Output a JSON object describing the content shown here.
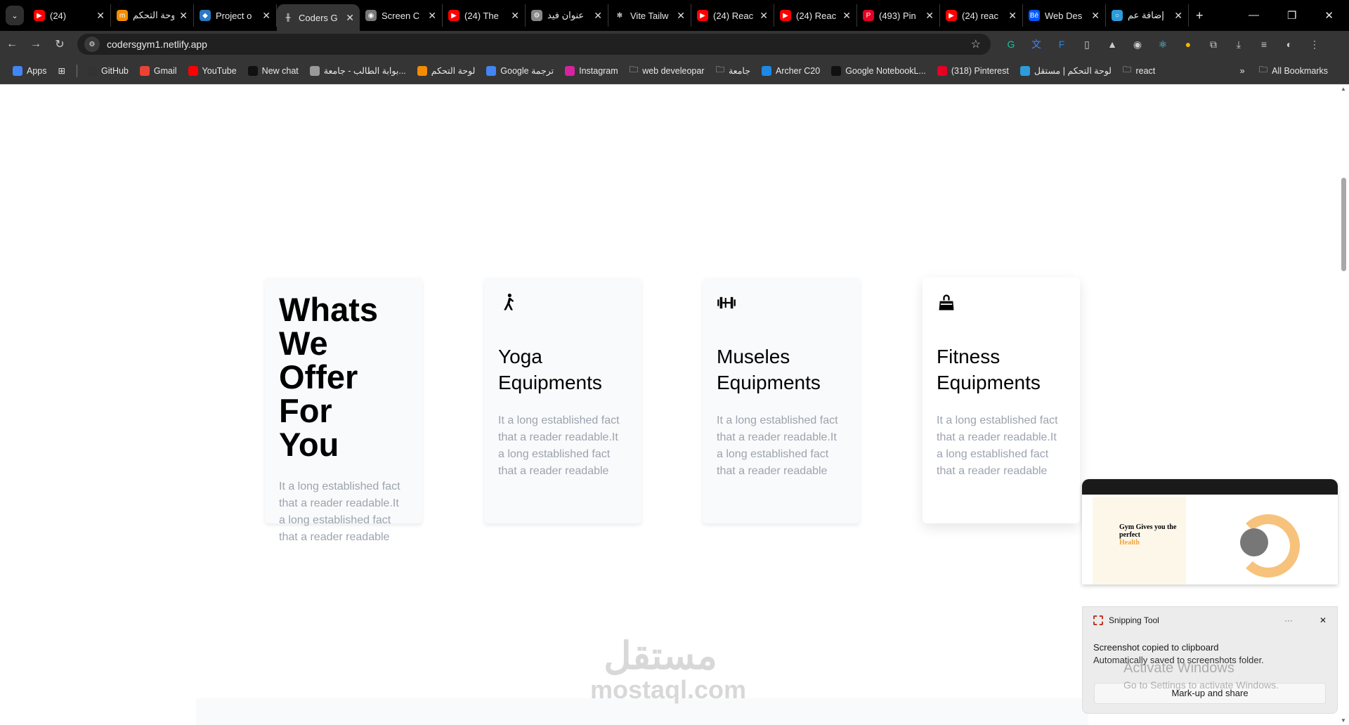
{
  "browser": {
    "tabs": [
      {
        "title": "(24)",
        "fav": "youtube-icon",
        "color": "#ff0000"
      },
      {
        "title": "لوحة التحكم",
        "fav": "mostaql-icon",
        "color": "#f28c00"
      },
      {
        "title": "Project o",
        "fav": "diamond-icon",
        "color": "#2b79c2"
      },
      {
        "title": "Coders G",
        "fav": "dumbbell-icon",
        "color": "#353535",
        "active": true
      },
      {
        "title": "Screen C",
        "fav": "camera-icon",
        "color": "#777"
      },
      {
        "title": "(24) The",
        "fav": "youtube-icon",
        "color": "#ff0000"
      },
      {
        "title": "عنوان فيد",
        "fav": "gear-icon",
        "color": "#888"
      },
      {
        "title": "Vite Tailw",
        "fav": "openai-icon",
        "color": "#000"
      },
      {
        "title": "(24) Reac",
        "fav": "youtube-icon",
        "color": "#ff0000"
      },
      {
        "title": "(24) Reac",
        "fav": "youtube-icon",
        "color": "#ff0000"
      },
      {
        "title": "(493) Pin",
        "fav": "pinterest-icon",
        "color": "#e60023"
      },
      {
        "title": "(24) reac",
        "fav": "youtube-icon",
        "color": "#ff0000"
      },
      {
        "title": "Web Des",
        "fav": "behance-icon",
        "color": "#0057ff"
      },
      {
        "title": "إضافة عم",
        "fav": "mostaql-circle-icon",
        "color": "#2d9cdb"
      }
    ],
    "url": "codersgym1.netlify.app",
    "bookmarks": [
      {
        "label": "Apps",
        "color": "#4285f4"
      },
      {
        "label": "GitHub",
        "color": "#333"
      },
      {
        "label": "Gmail",
        "color": "#ea4335"
      },
      {
        "label": "YouTube",
        "color": "#ff0000"
      },
      {
        "label": "New chat",
        "color": "#111"
      },
      {
        "label": "بوابة الطالب - جامعة...",
        "color": "#999"
      },
      {
        "label": "لوحة التحكم",
        "color": "#f28c00"
      },
      {
        "label": "Google ترجمة",
        "color": "#4285f4"
      },
      {
        "label": "Instagram",
        "color": "#d6249f"
      },
      {
        "label": "web develeopar",
        "color": "folder"
      },
      {
        "label": "جامعة",
        "color": "folder"
      },
      {
        "label": "Archer C20",
        "color": "#1e88e5"
      },
      {
        "label": "Google NotebookL...",
        "color": "#111"
      },
      {
        "label": "(318) Pinterest",
        "color": "#e60023"
      },
      {
        "label": "لوحة التحكم | مستقل",
        "color": "#2d9cdb"
      },
      {
        "label": "react",
        "color": "folder"
      }
    ],
    "all_bookmarks": "All Bookmarks"
  },
  "page": {
    "intro": {
      "title": "Whats We Offer For You",
      "text": "It a long established fact that a reader readable.It a long established fact that a reader readable"
    },
    "cards": [
      {
        "title": "Yoga Equipments",
        "icon": "yoga-icon",
        "text": "It a long established fact that a reader readable.It a long established fact that a reader readable"
      },
      {
        "title": "Museles Equipments",
        "icon": "dumbbell-icon",
        "text": "It a long established fact that a reader readable.It a long established fact that a reader readable"
      },
      {
        "title": "Fitness Equipments",
        "icon": "gym-bag-icon",
        "text": "It a long established fact that a reader readable.It a long established fact that a reader readable"
      }
    ],
    "watermark": {
      "ar": "مستقل",
      "en": "mostaql.com"
    }
  },
  "snip": {
    "preview_heading": "Gym Gives you the perfect",
    "preview_highlight": "Health",
    "app": "Snipping Tool",
    "more": "···",
    "title": "Screenshot copied to clipboard",
    "subtitle": "Automatically saved to screenshots folder.",
    "action": "Mark-up and share"
  },
  "activate": {
    "line1": "Activate Windows",
    "line2": "Go to Settings to activate Windows."
  }
}
